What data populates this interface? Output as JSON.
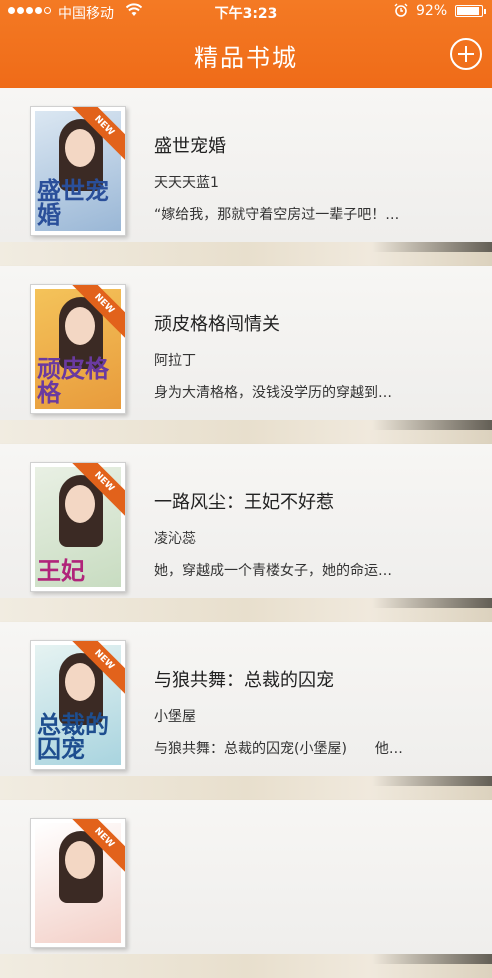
{
  "status_bar": {
    "carrier": "中国移动",
    "time": "下午3:23",
    "battery": "92%",
    "battery_level": 0.92,
    "signal_bars": 4,
    "signal_max": 5
  },
  "header": {
    "title": "精品书城",
    "add_icon": "plus-circle-icon",
    "color": "#f07020"
  },
  "books": [
    {
      "title": "盛世宠婚",
      "author": "天天天蓝1",
      "desc": "“嫁给我，那就守着空房过一辈子吧！…",
      "badge": "NEW",
      "cover_text": "盛世宠婚",
      "cover_colors": [
        "#dbe7f2",
        "#9ab7d6"
      ],
      "cover_text_color": "#2a4f9a"
    },
    {
      "title": "顽皮格格闯情关",
      "author": "阿拉丁",
      "desc": "身为大清格格，没钱没学历的穿越到…",
      "badge": "NEW",
      "cover_text": "顽皮格格",
      "cover_colors": [
        "#f4c35a",
        "#e89b3c"
      ],
      "cover_text_color": "#6a3aa0"
    },
    {
      "title": "一路风尘：王妃不好惹",
      "author": "凌沁蕊",
      "desc": "她，穿越成一个青楼女子，她的命运…",
      "badge": "NEW",
      "cover_text": "王妃",
      "cover_colors": [
        "#e9f0e4",
        "#c8dcc1"
      ],
      "cover_text_color": "#b0247a"
    },
    {
      "title": "与狼共舞：总裁的囚宠",
      "author": "小堡屋",
      "desc": "与狼共舞：总裁的囚宠(小堡屋)　　他…",
      "badge": "NEW",
      "cover_text": "总裁的囚宠",
      "cover_colors": [
        "#e6f3f2",
        "#a9d4df"
      ],
      "cover_text_color": "#1e4e8f"
    },
    {
      "title": "",
      "author": "",
      "desc": "",
      "badge": "NEW",
      "cover_text": "",
      "cover_colors": [
        "#ffffff",
        "#f3d0c8"
      ],
      "cover_text_color": "#c0392b"
    }
  ]
}
